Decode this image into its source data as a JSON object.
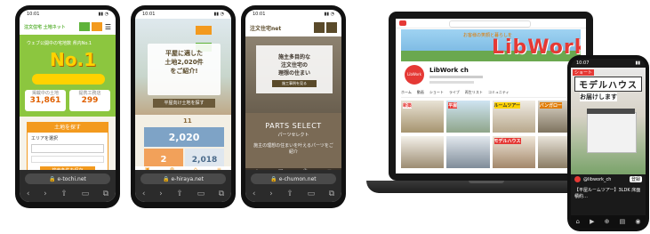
{
  "phone1": {
    "time": "10:01",
    "logo": "注文住宅 土地ネット",
    "hero_headline": "No.1",
    "hero_sub": "ウェブ公開中の宅地数 県内No.1",
    "stat1_label": "掲載中の土地",
    "stat1_value": "31,861",
    "stat2_label": "提携工務店",
    "stat2_value": "299",
    "card_title": "土地を探す",
    "area_label": "エリアを選択",
    "search_button": "検索条件を保存",
    "url": "e-tochi.net"
  },
  "phone2": {
    "time": "10:01",
    "hero_line1": "平屋に適した",
    "hero_line2": "土地2,020件",
    "hero_line3": "をご紹介!",
    "hero_button": "平屋向け土地を探す",
    "count_text": "11",
    "stat1_value": "2,020",
    "stat2_value": "2",
    "stat3_value": "2,018",
    "url": "e-hiraya.net"
  },
  "phone3": {
    "time": "10:01",
    "logo": "注文住宅net",
    "hero_line1": "施主多目的な",
    "hero_line2": "注文住宅の",
    "hero_line3": "理想の住まい",
    "hero_button": "施工事例を見る",
    "parts_title": "PARTS SELECT",
    "parts_sub": "パーツセレクト",
    "parts_desc": "施主の理想の住まいを叶えるパーツをご紹介",
    "url": "e-chumon.net"
  },
  "laptop": {
    "banner_text": "LibWork",
    "banner_small": "お客様の笑顔と暮らしを",
    "channel_name": "LibWork ch",
    "avatar_text": "LibWork",
    "tabs": [
      "ホーム",
      "動画",
      "ショート",
      "ライブ",
      "再生リスト",
      "コミュニティ"
    ],
    "thumb_labels": [
      "新築",
      "平屋",
      "ルームツアー",
      "バンガロー",
      "モデルハウス"
    ]
  },
  "phone4": {
    "time": "10:07",
    "sign_text": "モデルハウス",
    "sub_text": "お届けします",
    "badge": "ショート",
    "caption": "【平屋ルームツアー】3LDK 床面積約…",
    "channel": "@libwork_ch",
    "subscribe": "登録"
  },
  "colors": {
    "green": "#5fb33a",
    "orange": "#f39a1e",
    "yellow": "#ffd200",
    "youtube_red": "#e53935"
  }
}
